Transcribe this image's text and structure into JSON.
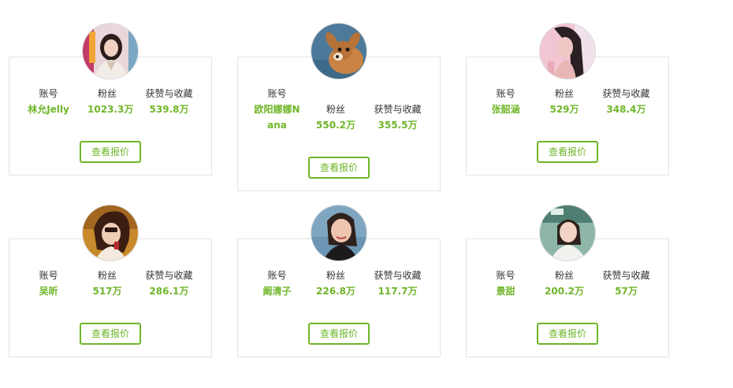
{
  "colors": {
    "accent": "#6fb628",
    "border": "#e3e3e3"
  },
  "labels": {
    "account": "账号",
    "fans": "粉丝",
    "likes": "获赞与收藏"
  },
  "button_label": "查看报价",
  "cards": [
    {
      "name": "林允Jelly",
      "fans": "1023.3万",
      "likes": "539.8万",
      "avatar_icon": "portrait-girl-icon"
    },
    {
      "name": "欧阳娜娜Nana",
      "fans": "550.2万",
      "likes": "355.5万",
      "avatar_icon": "fawn-icon"
    },
    {
      "name": "张韶涵",
      "fans": "529万",
      "likes": "348.4万",
      "avatar_icon": "portrait-woman-icon"
    },
    {
      "name": "吴昕",
      "fans": "517万",
      "likes": "286.1万",
      "avatar_icon": "portrait-woman-icon"
    },
    {
      "name": "阚清子",
      "fans": "226.8万",
      "likes": "117.7万",
      "avatar_icon": "portrait-woman-icon"
    },
    {
      "name": "景甜",
      "fans": "200.2万",
      "likes": "57万",
      "avatar_icon": "portrait-woman-icon"
    }
  ]
}
